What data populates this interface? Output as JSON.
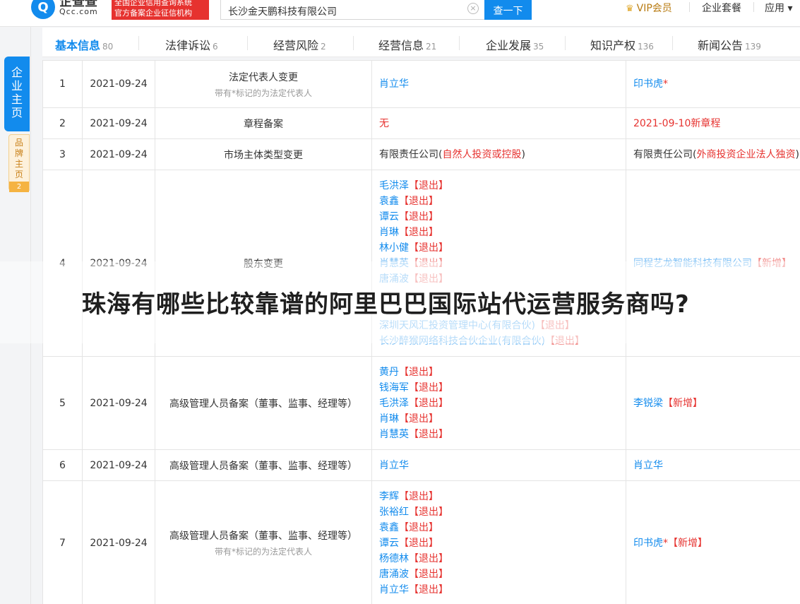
{
  "header": {
    "logo_mark": "Q",
    "logo_cn": "企查查",
    "logo_en": "Qcc.com",
    "badge_line1": "全国企业信用查询系统",
    "badge_line2": "官方备案企业征信机构",
    "search_value": "长沙金天鹏科技有限公司",
    "search_clear": "×",
    "search_button": "查一下",
    "vip_label": "VIP会员",
    "package_label": "企业套餐",
    "apps_label": "应用 ▾"
  },
  "sidebar": {
    "main_label": [
      "企",
      "业",
      "主",
      "页"
    ],
    "brand_label": [
      "品",
      "牌",
      "主",
      "页"
    ],
    "brand_count": "2"
  },
  "tabs": [
    {
      "label": "基本信息",
      "count": "80",
      "active": true
    },
    {
      "label": "法律诉讼",
      "count": "6"
    },
    {
      "label": "经营风险",
      "count": "2"
    },
    {
      "label": "经营信息",
      "count": "21"
    },
    {
      "label": "企业发展",
      "count": "35"
    },
    {
      "label": "知识产权",
      "count": "136"
    },
    {
      "label": "新闻公告",
      "count": "139"
    }
  ],
  "rows": [
    {
      "no": "1",
      "date": "2021-09-24",
      "item": "法定代表人变更",
      "note": "带有*标记的为法定代表人",
      "before": [
        [
          {
            "t": "肖立华",
            "c": "blue"
          }
        ]
      ],
      "after": [
        [
          {
            "t": "印书虎",
            "c": "blue"
          },
          {
            "t": "*",
            "c": "red"
          }
        ]
      ]
    },
    {
      "no": "2",
      "date": "2021-09-24",
      "item": "章程备案",
      "before": [
        [
          {
            "t": "无",
            "c": "red"
          }
        ]
      ],
      "after": [
        [
          {
            "t": "2021-09-10新章程",
            "c": "red"
          }
        ]
      ]
    },
    {
      "no": "3",
      "date": "2021-09-24",
      "item": "市场主体类型变更",
      "before": [
        [
          {
            "t": "有限责任公司(",
            "c": ""
          },
          {
            "t": "自然人投资或控股",
            "c": "red"
          },
          {
            "t": ")",
            "c": ""
          }
        ]
      ],
      "after": [
        [
          {
            "t": "有限责任公司(",
            "c": ""
          },
          {
            "t": "外商投资企业法人独资",
            "c": "red"
          },
          {
            "t": ")",
            "c": ""
          }
        ]
      ]
    },
    {
      "no": "4",
      "date": "2021-09-24",
      "item": "股东变更",
      "before": [
        [
          {
            "t": "毛洪泽",
            "c": "blue"
          },
          {
            "t": "【退出】",
            "c": "red"
          }
        ],
        [
          {
            "t": "袁鑫",
            "c": "blue"
          },
          {
            "t": "【退出】",
            "c": "red"
          }
        ],
        [
          {
            "t": "谭云",
            "c": "blue"
          },
          {
            "t": "【退出】",
            "c": "red"
          }
        ],
        [
          {
            "t": "肖琳",
            "c": "blue"
          },
          {
            "t": "【退出】",
            "c": "red"
          }
        ],
        [
          {
            "t": "林小健",
            "c": "blue"
          },
          {
            "t": "【退出】",
            "c": "red"
          }
        ],
        [
          {
            "t": "肖慧英",
            "c": "blue"
          },
          {
            "t": "【退出】",
            "c": "red"
          }
        ],
        [
          {
            "t": "唐涌波",
            "c": "blue"
          },
          {
            "t": "【退出】",
            "c": "red"
          }
        ],
        [
          {
            "t": "",
            "c": ""
          }
        ],
        [
          {
            "t": "",
            "c": ""
          }
        ],
        [
          {
            "t": "深圳天风汇投资管理中心(有限合伙)",
            "c": "blue"
          },
          {
            "t": "【退出】",
            "c": "red"
          }
        ],
        [
          {
            "t": "长沙醉猴网络科技合伙企业(有限合伙)",
            "c": "blue"
          },
          {
            "t": "【退出】",
            "c": "red"
          }
        ]
      ],
      "after": [
        [
          {
            "t": "同程艺龙智能科技有限公司",
            "c": "blue"
          },
          {
            "t": "【新增】",
            "c": "red"
          }
        ]
      ]
    },
    {
      "no": "5",
      "date": "2021-09-24",
      "item": "高级管理人员备案（董事、监事、经理等）",
      "before": [
        [
          {
            "t": "黄丹",
            "c": "blue"
          },
          {
            "t": "【退出】",
            "c": "red"
          }
        ],
        [
          {
            "t": "钱海军",
            "c": "blue"
          },
          {
            "t": "【退出】",
            "c": "red"
          }
        ],
        [
          {
            "t": "毛洪泽",
            "c": "blue"
          },
          {
            "t": "【退出】",
            "c": "red"
          }
        ],
        [
          {
            "t": "肖琳",
            "c": "blue"
          },
          {
            "t": "【退出】",
            "c": "red"
          }
        ],
        [
          {
            "t": "肖慧英",
            "c": "blue"
          },
          {
            "t": "【退出】",
            "c": "red"
          }
        ]
      ],
      "after": [
        [
          {
            "t": "李锐梁",
            "c": "blue"
          },
          {
            "t": "【新增】",
            "c": "red"
          }
        ]
      ]
    },
    {
      "no": "6",
      "date": "2021-09-24",
      "item": "高级管理人员备案（董事、监事、经理等）",
      "before": [
        [
          {
            "t": "肖立华",
            "c": "blue"
          }
        ]
      ],
      "after": [
        [
          {
            "t": "肖立华",
            "c": "blue"
          }
        ]
      ]
    },
    {
      "no": "7",
      "date": "2021-09-24",
      "item": "高级管理人员备案（董事、监事、经理等）",
      "note": "带有*标记的为法定代表人",
      "before": [
        [
          {
            "t": "李辉",
            "c": "blue"
          },
          {
            "t": "【退出】",
            "c": "red"
          }
        ],
        [
          {
            "t": "张裕红",
            "c": "blue"
          },
          {
            "t": "【退出】",
            "c": "red"
          }
        ],
        [
          {
            "t": "袁鑫",
            "c": "blue"
          },
          {
            "t": "【退出】",
            "c": "red"
          }
        ],
        [
          {
            "t": "谭云",
            "c": "blue"
          },
          {
            "t": "【退出】",
            "c": "red"
          }
        ],
        [
          {
            "t": "杨德林",
            "c": "blue"
          },
          {
            "t": "【退出】",
            "c": "red"
          }
        ],
        [
          {
            "t": "唐涌波",
            "c": "blue"
          },
          {
            "t": "【退出】",
            "c": "red"
          }
        ],
        [
          {
            "t": "肖立华",
            "c": "blue"
          },
          {
            "t": "【退出】",
            "c": "red"
          }
        ]
      ],
      "after": [
        [
          {
            "t": "印书虎",
            "c": "blue"
          },
          {
            "t": "*",
            "c": "red"
          },
          {
            "t": "【新增】",
            "c": "red"
          }
        ]
      ]
    }
  ],
  "overlay_title": "珠海有哪些比较靠谱的阿里巴巴国际站代运营服务商吗?"
}
